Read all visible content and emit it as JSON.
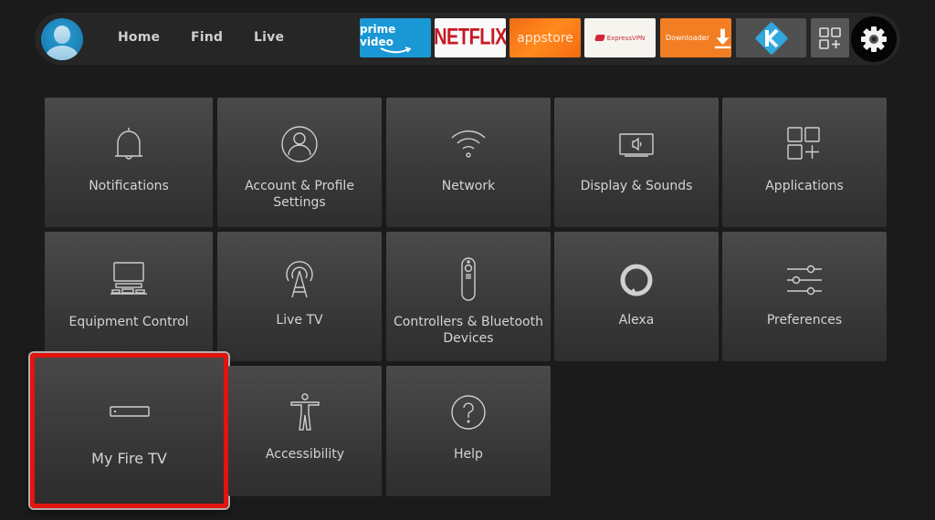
{
  "topbar": {
    "profile": {
      "icon": "profile-avatar-icon"
    },
    "nav": [
      {
        "label": "Home"
      },
      {
        "label": "Find"
      },
      {
        "label": "Live"
      }
    ],
    "apps": [
      {
        "name": "prime video",
        "brand_color": "#1a98d5"
      },
      {
        "name": "NETFLIX",
        "brand_color": "#c81924"
      },
      {
        "name": "appstore",
        "brand_color": "#f36b15"
      },
      {
        "name": "ExpressVPN",
        "brand_color": "#d3263a"
      },
      {
        "name": "Downloader",
        "brand_color": "#f27d23"
      },
      {
        "name": "Kodi",
        "brand_color": "#30a7dd"
      },
      {
        "name": "All Apps",
        "icon": "apps-grid-icon"
      }
    ],
    "settings": {
      "icon": "gear-icon"
    }
  },
  "settings_grid": {
    "tiles": [
      {
        "label": "Notifications",
        "icon": "bell-icon"
      },
      {
        "label": "Account & Profile Settings",
        "icon": "account-icon"
      },
      {
        "label": "Network",
        "icon": "wifi-icon"
      },
      {
        "label": "Display & Sounds",
        "icon": "display-sound-icon"
      },
      {
        "label": "Applications",
        "icon": "applications-icon"
      },
      {
        "label": "Equipment Control",
        "icon": "equipment-icon"
      },
      {
        "label": "Live TV",
        "icon": "antenna-icon"
      },
      {
        "label": "Controllers & Bluetooth Devices",
        "icon": "remote-icon"
      },
      {
        "label": "Alexa",
        "icon": "alexa-icon"
      },
      {
        "label": "Preferences",
        "icon": "sliders-icon"
      },
      {
        "label": "My Fire TV",
        "icon": "fire-tv-device-icon",
        "selected": true
      },
      {
        "label": "Accessibility",
        "icon": "accessibility-icon"
      },
      {
        "label": "Help",
        "icon": "help-icon"
      }
    ],
    "highlight_color": "#e01410"
  }
}
